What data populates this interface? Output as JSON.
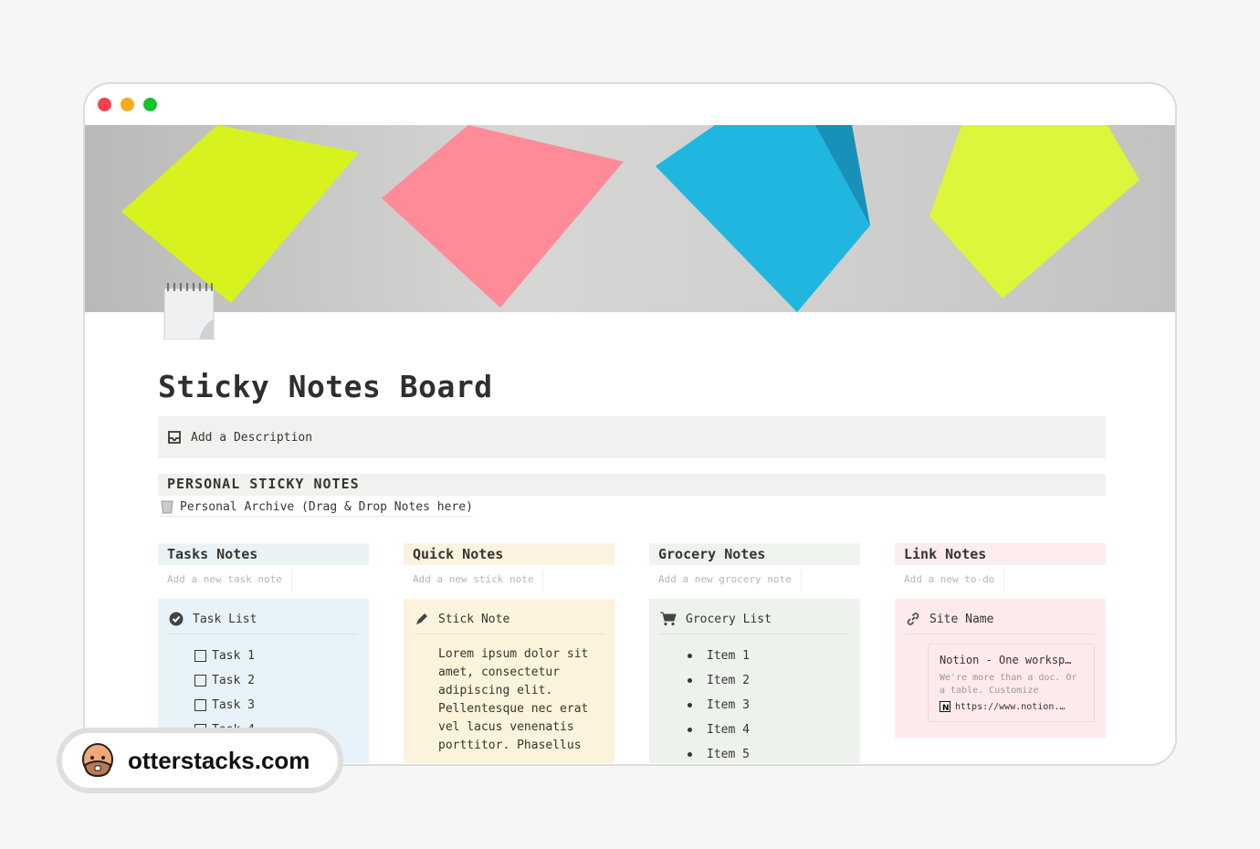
{
  "window": {
    "controls": [
      "close",
      "minimize",
      "maximize"
    ],
    "colors": {
      "close": "#f0424c",
      "minimize": "#f7ab17",
      "maximize": "#12c42f"
    }
  },
  "banner": {
    "note_colors": [
      "#d8f21f",
      "#ff8b99",
      "#21b6e0",
      "#ddf53a"
    ]
  },
  "page": {
    "title": "Sticky Notes Board",
    "description": "Add a Description",
    "section_title": "PERSONAL STICKY NOTES",
    "archive_link": "Personal Archive (Drag & Drop Notes here)"
  },
  "columns": [
    {
      "title": "Tasks Notes",
      "placeholder": "Add a new task note",
      "bg": "#e7f3f8",
      "card": {
        "title": "Task List",
        "icon": "check-circle-icon",
        "items": [
          "Task 1",
          "Task 2",
          "Task 3",
          "Task 4"
        ]
      }
    },
    {
      "title": "Quick Notes",
      "placeholder": "Add a new stick note",
      "bg": "#fbf3db",
      "card": {
        "title": "Stick Note",
        "icon": "pencil-icon",
        "text": "Lorem ipsum dolor sit amet, consectetur adipiscing elit. Pellentesque nec erat vel lacus venenatis porttitor. Phasellus"
      }
    },
    {
      "title": "Grocery Notes",
      "placeholder": "Add a new grocery note",
      "bg": "#edf3ec",
      "card": {
        "title": "Grocery List",
        "icon": "cart-icon",
        "items": [
          "Item 1",
          "Item 2",
          "Item 3",
          "Item 4",
          "Item 5"
        ]
      }
    },
    {
      "title": "Link Notes",
      "placeholder": "Add a new to-do",
      "bg": "#fdebec",
      "card": {
        "title": "Site Name",
        "icon": "link-icon",
        "bookmark": {
          "title": "Notion - One worksp…",
          "desc": "We're more than a doc. Or a table. Customize",
          "url": "https://www.notion.…"
        }
      }
    }
  ],
  "watermark": {
    "text": "otterstacks.com"
  }
}
